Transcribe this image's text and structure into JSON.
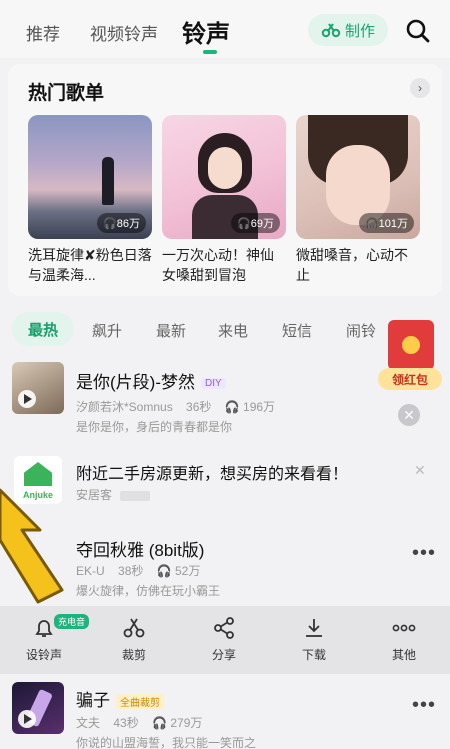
{
  "topbar": {
    "tabs": [
      "推荐",
      "视频铃声",
      "铃声"
    ],
    "make_label": "制作"
  },
  "hot": {
    "title": "热门歌单",
    "albums": [
      {
        "plays": "86万",
        "caption": "洗耳旋律✘粉色日落与温柔海..."
      },
      {
        "plays": "69万",
        "caption": "一万次心动！神仙女嗓甜到冒泡"
      },
      {
        "plays": "101万",
        "caption": "微甜嗓音，心动不止"
      }
    ]
  },
  "categories": [
    "最热",
    "飙升",
    "最新",
    "来电",
    "短信",
    "闹铃"
  ],
  "redpack": {
    "label": "领红包"
  },
  "songs": [
    {
      "title": "是你(片段)-梦然",
      "tag": "DIY",
      "artist": "汐颜若沐*Somnus",
      "duration": "36秒",
      "plays": "196万",
      "desc": "是你是你，身后的青春都是你"
    },
    {
      "title": "夺回秋雅 (8bit版)",
      "tag": "",
      "artist": "EK-U",
      "duration": "38秒",
      "plays": "52万",
      "desc": "爆火旋律，仿佛在玩小霸王"
    },
    {
      "title": "骗子",
      "tag": "全曲裁剪",
      "artist": "文夫",
      "duration": "43秒",
      "plays": "279万",
      "desc": "你说的山盟海誓，我只能一笑而之"
    }
  ],
  "ad": {
    "text": "附近二手房源更新，想买房的来看看！",
    "source": "安居客",
    "logo_text": "Anjuke"
  },
  "action_bar": {
    "badge": "充电音",
    "items": [
      {
        "label": "设铃声",
        "icon": "bell-icon"
      },
      {
        "label": "裁剪",
        "icon": "scissors-icon"
      },
      {
        "label": "分享",
        "icon": "share-icon"
      },
      {
        "label": "下载",
        "icon": "download-icon"
      },
      {
        "label": "其他",
        "icon": "more-icon"
      }
    ]
  },
  "colors": {
    "accent": "#1fb37e",
    "background": "#f2f2f4"
  }
}
